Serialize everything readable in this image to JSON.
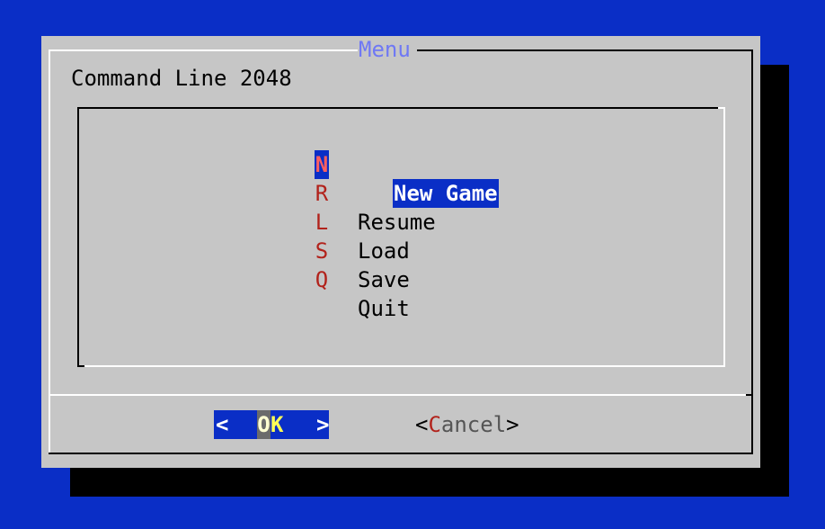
{
  "dialog": {
    "title": "Menu",
    "prompt": "Command Line 2048"
  },
  "menu": {
    "items": [
      {
        "key": "N",
        "label": "New Game",
        "selected": true
      },
      {
        "key": "R",
        "label": "Resume",
        "selected": false
      },
      {
        "key": "L",
        "label": "Load",
        "selected": false
      },
      {
        "key": "S",
        "label": "Save",
        "selected": false
      },
      {
        "key": "Q",
        "label": "Quit",
        "selected": false
      }
    ]
  },
  "buttons": {
    "ok": {
      "left_bracket": "<",
      "hotkey": "O",
      "rest": "K",
      "right_bracket": ">",
      "selected": true
    },
    "cancel": {
      "left_bracket": "<",
      "hotkey": "C",
      "rest": "ancel",
      "right_bracket": ">",
      "selected": false
    }
  },
  "colors": {
    "background": "#0a2ec6",
    "dialog": "#c6c6c6",
    "title": "#6f78f4",
    "hotkey": "#b2221b",
    "selection": "#0a2ec6"
  }
}
